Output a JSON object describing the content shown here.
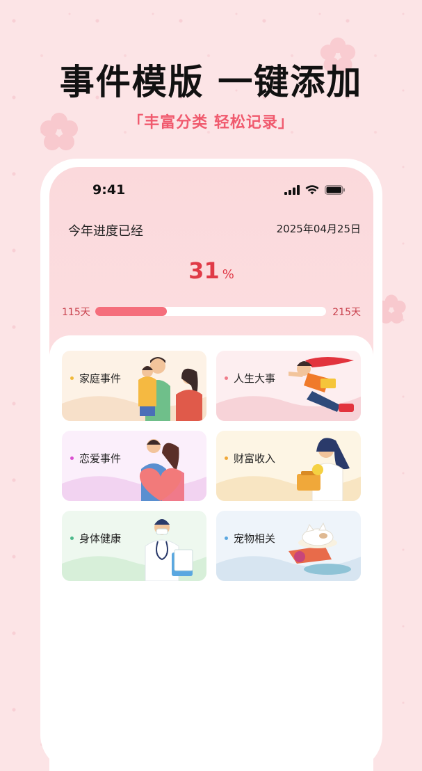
{
  "promo": {
    "headline": "事件模版 一键添加",
    "subline": "「丰富分类 轻松记录」"
  },
  "status_bar": {
    "time": "9:41"
  },
  "progress": {
    "title": "今年进度已经",
    "date": "2025年04月25日",
    "percent": "31",
    "percent_unit": "%",
    "fraction": 0.31,
    "days_passed": "115天",
    "days_remaining": "215天"
  },
  "categories": [
    {
      "label": "家庭事件",
      "dot_color": "#f0b93a",
      "bg": "#fdf2e6",
      "wave": "#f7e0c9"
    },
    {
      "label": "人生大事",
      "dot_color": "#f07c8a",
      "bg": "#fdeef0",
      "wave": "#f7d3d8"
    },
    {
      "label": "恋爱事件",
      "dot_color": "#d94fd0",
      "bg": "#fbeffb",
      "wave": "#f2d3f1"
    },
    {
      "label": "财富收入",
      "dot_color": "#f0a83a",
      "bg": "#fdf5e4",
      "wave": "#f8e5c2"
    },
    {
      "label": "身体健康",
      "dot_color": "#4cb88a",
      "bg": "#eef8ef",
      "wave": "#d7efd9"
    },
    {
      "label": "宠物相关",
      "dot_color": "#5aa7e0",
      "bg": "#eef4fa",
      "wave": "#d7e5f1"
    }
  ],
  "colors": {
    "accent": "#e03a47",
    "progress_fill": "#f56e7c",
    "subline": "#f05a6e"
  }
}
